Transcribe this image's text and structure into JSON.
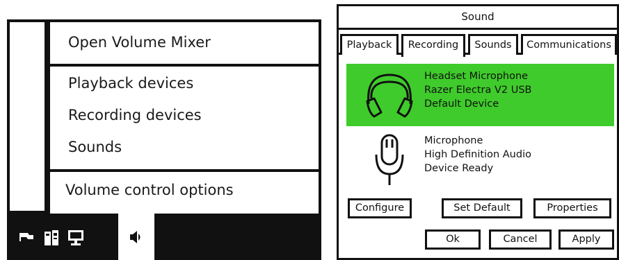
{
  "tray_menu": {
    "items": [
      {
        "label": "Open Volume Mixer"
      },
      {
        "label": "Playback devices"
      },
      {
        "label": "Recording devices"
      },
      {
        "label": "Sounds"
      },
      {
        "label": "Volume control options"
      }
    ],
    "taskbar_icons": [
      "flag-icon",
      "device-icon",
      "network-icon",
      "speaker-icon"
    ]
  },
  "sound_dialog": {
    "title": "Sound",
    "tabs": [
      {
        "label": "Playback"
      },
      {
        "label": "Recording",
        "selected": true
      },
      {
        "label": "Sounds"
      },
      {
        "label": "Communications"
      }
    ],
    "devices": [
      {
        "icon": "headset-icon",
        "name": "Headset Microphone",
        "model": "Razer Electra V2 USB",
        "status": "Default Device",
        "selected": true
      },
      {
        "icon": "microphone-icon",
        "name": "Microphone",
        "model": "High Definition Audio",
        "status": "Device Ready",
        "selected": false
      }
    ],
    "buttons": {
      "configure": "Configure",
      "set_default": "Set Default",
      "properties": "Properties",
      "ok": "Ok",
      "cancel": "Cancel",
      "apply": "Apply"
    },
    "colors": {
      "selected_device": "#3fcb2b"
    }
  }
}
